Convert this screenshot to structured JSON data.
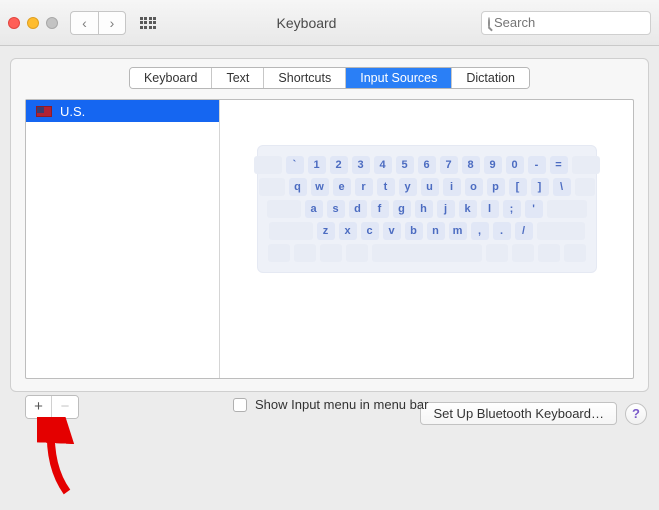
{
  "window": {
    "title": "Keyboard"
  },
  "search": {
    "placeholder": "Search"
  },
  "tabs": [
    {
      "label": "Keyboard",
      "selected": false
    },
    {
      "label": "Text",
      "selected": false
    },
    {
      "label": "Shortcuts",
      "selected": false
    },
    {
      "label": "Input Sources",
      "selected": true
    },
    {
      "label": "Dictation",
      "selected": false
    }
  ],
  "sources": [
    {
      "label": "U.S.",
      "flag": "us",
      "selected": true
    }
  ],
  "checkbox": {
    "label": "Show Input menu in menu bar",
    "checked": false
  },
  "footer": {
    "setup_button": "Set Up Bluetooth Keyboard…"
  },
  "keyboard_preview": {
    "rows": [
      [
        "`",
        "1",
        "2",
        "3",
        "4",
        "5",
        "6",
        "7",
        "8",
        "9",
        "0",
        "-",
        "="
      ],
      [
        "q",
        "w",
        "e",
        "r",
        "t",
        "y",
        "u",
        "i",
        "o",
        "p",
        "[",
        "]",
        "\\"
      ],
      [
        "a",
        "s",
        "d",
        "f",
        "g",
        "h",
        "j",
        "k",
        "l",
        ";",
        "'"
      ],
      [
        "z",
        "x",
        "c",
        "v",
        "b",
        "n",
        "m",
        ",",
        ".",
        "/"
      ]
    ]
  },
  "annotation": {
    "arrow_points_to": "add-button"
  }
}
